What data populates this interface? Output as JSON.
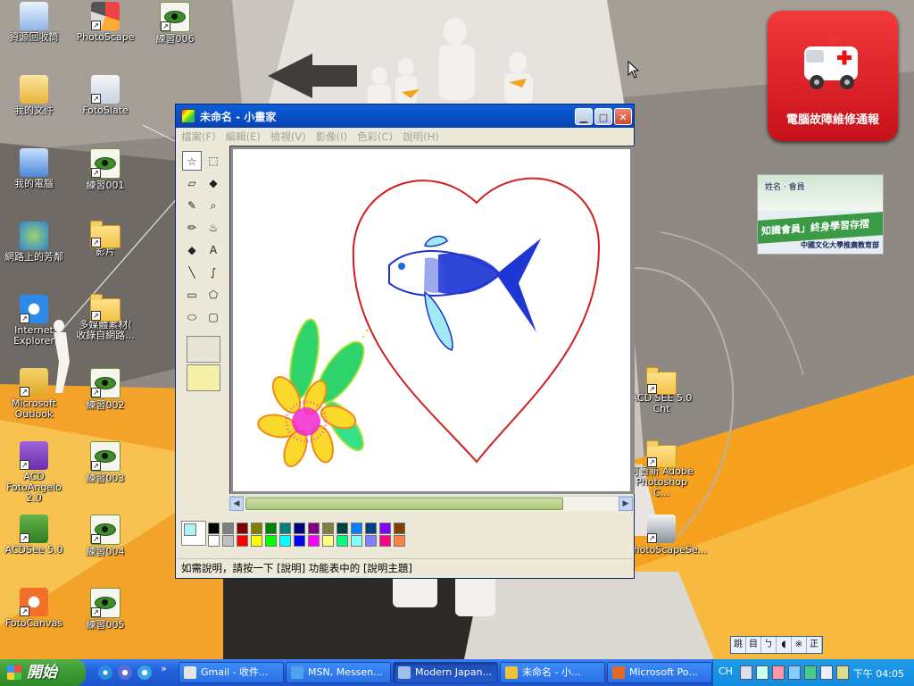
{
  "desktop": {
    "icons": [
      {
        "label": "資源回收筒",
        "icon": "recycle-bin-icon"
      },
      {
        "label": "PhotoScape",
        "icon": "photoscape-icon"
      },
      {
        "label": "練習006",
        "icon": "acdsee-image-icon"
      },
      {
        "label": "我的文件",
        "icon": "my-documents-icon"
      },
      {
        "label": "FotoSlate",
        "icon": "fotoslate-icon"
      },
      {
        "label": "我的電腦",
        "icon": "my-computer-icon"
      },
      {
        "label": "練習001",
        "icon": "acdsee-image-icon"
      },
      {
        "label": "網路上的芳鄰",
        "icon": "network-places-icon"
      },
      {
        "label": "影片",
        "icon": "folder-icon"
      },
      {
        "label": "Internet\nExplorer",
        "icon": "internet-explorer-icon"
      },
      {
        "label": "多媒體素材(\n收錄自網路...",
        "icon": "folder-icon"
      },
      {
        "label": "Microsoft\nOutlook",
        "icon": "outlook-icon"
      },
      {
        "label": "練習002",
        "icon": "acdsee-image-icon"
      },
      {
        "label": "ACD\nFotoAngelo 2.0",
        "icon": "fotoangelo-icon"
      },
      {
        "label": "練習003",
        "icon": "acdsee-image-icon"
      },
      {
        "label": "ACDSee 5.0",
        "icon": "acdsee-icon"
      },
      {
        "label": "練習004",
        "icon": "acdsee-image-icon"
      },
      {
        "label": "FotoCanvas",
        "icon": "fotocanvas-icon"
      },
      {
        "label": "練習005",
        "icon": "acdsee-image-icon"
      },
      {
        "label": "ACD SEE 5.0\nCht",
        "icon": "folder-icon"
      },
      {
        "label": "可貴新 Adobe\nPhotoshop C...",
        "icon": "folder-icon"
      },
      {
        "label": "PhotoScapeSe...",
        "icon": "computer-shortcut-icon"
      }
    ],
    "widget": {
      "caption": "電腦故障維修通報"
    },
    "banner": {
      "top_text": "姓名 · 會員",
      "strip_text": "知識會員」終身學習存摺",
      "bottom_text": "中國文化大學推廣教育部"
    }
  },
  "paint": {
    "title": "未命名 - 小畫家",
    "menu": [
      "檔案(F)",
      "編輯(E)",
      "檢視(V)",
      "影像(I)",
      "色彩(C)",
      "說明(H)"
    ],
    "status": "如需說明，請按一下 [說明] 功能表中的 [說明主題]",
    "tools": [
      {
        "name": "free-select-tool",
        "glyph": "☆"
      },
      {
        "name": "rect-select-tool",
        "glyph": "⬚"
      },
      {
        "name": "eraser-tool",
        "glyph": "▱"
      },
      {
        "name": "fill-tool",
        "glyph": "◆"
      },
      {
        "name": "pick-color-tool",
        "glyph": "✎"
      },
      {
        "name": "magnifier-tool",
        "glyph": "⌕"
      },
      {
        "name": "pencil-tool",
        "glyph": "✏"
      },
      {
        "name": "brush-tool",
        "glyph": "♨"
      },
      {
        "name": "airbrush-tool",
        "glyph": "◆"
      },
      {
        "name": "text-tool",
        "glyph": "A"
      },
      {
        "name": "line-tool",
        "glyph": "╲"
      },
      {
        "name": "curve-tool",
        "glyph": "∫"
      },
      {
        "name": "rectangle-tool",
        "glyph": "▭"
      },
      {
        "name": "polygon-tool",
        "glyph": "⬠"
      },
      {
        "name": "ellipse-tool",
        "glyph": "⬭"
      },
      {
        "name": "rounded-rect-tool",
        "glyph": "▢"
      }
    ],
    "palette_top": [
      "#000000",
      "#808080",
      "#800000",
      "#808000",
      "#008000",
      "#008080",
      "#000080",
      "#800080",
      "#808040",
      "#004040",
      "#0080ff",
      "#004080",
      "#8000ff",
      "#804000"
    ],
    "palette_bottom": [
      "#ffffff",
      "#c0c0c0",
      "#ff0000",
      "#ffff00",
      "#00ff00",
      "#00ffff",
      "#0000ff",
      "#ff00ff",
      "#ffff80",
      "#00ff80",
      "#80ffff",
      "#8080ff",
      "#ff0080",
      "#ff8040"
    ],
    "foreground_color": "#aef3f2",
    "background_color": "#ffffff"
  },
  "taskbar": {
    "start_label": "開始",
    "tasks": [
      {
        "label": "Gmail - 收件...",
        "icon_color": "#e6e6e6"
      },
      {
        "label": "MSN, Messen...",
        "icon_color": "#4fa3e8"
      },
      {
        "label": "Modern Japan...",
        "icon_color": "#9fbfe8"
      },
      {
        "label": "未命名 - 小...",
        "icon_color": "#f0c040"
      },
      {
        "label": "Microsoft Po...",
        "icon_color": "#e06a2a"
      }
    ],
    "tray": {
      "lang": "CH",
      "time": "下午 04:05"
    },
    "ime": [
      "跳",
      "目",
      "ㄅ",
      "◖",
      "※",
      "正"
    ]
  }
}
